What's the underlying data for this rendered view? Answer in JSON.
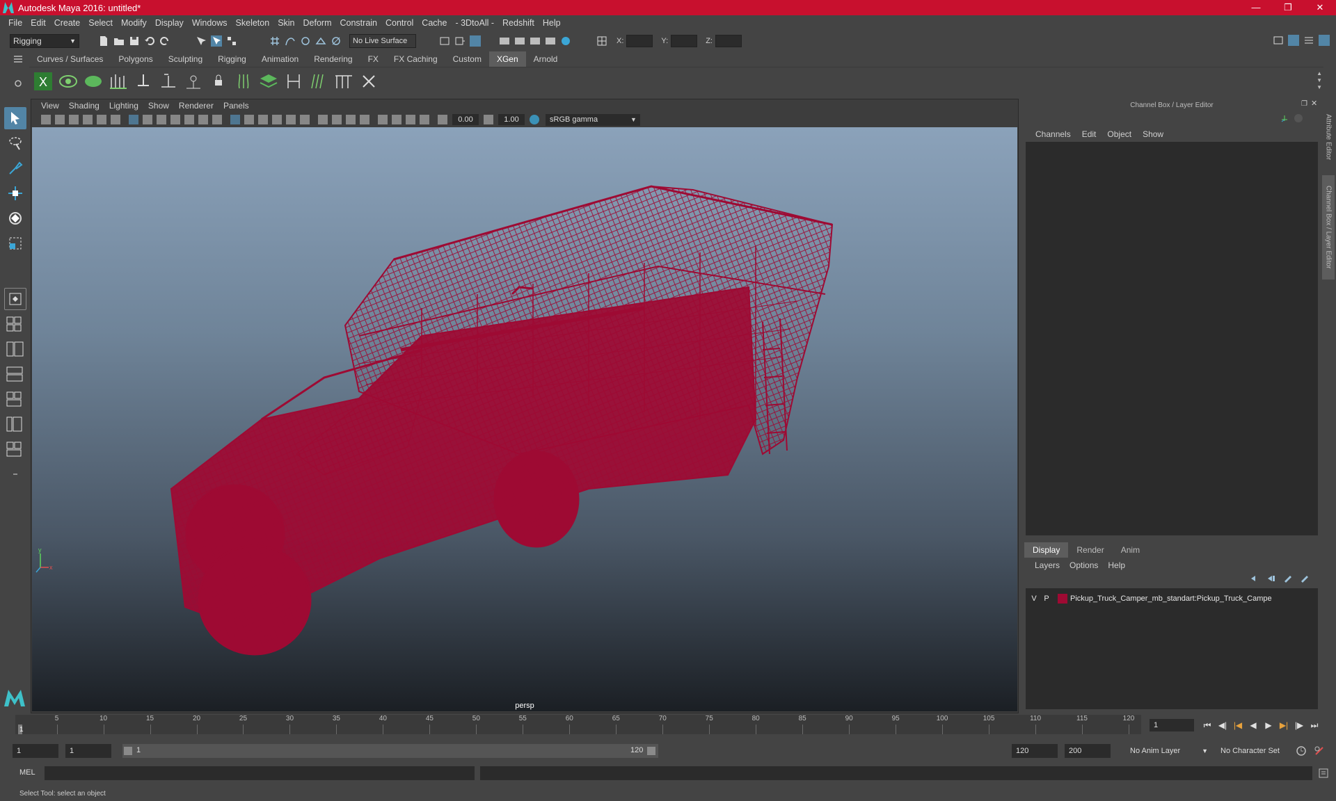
{
  "window": {
    "title": "Autodesk Maya 2016: untitled*"
  },
  "menubar": [
    "File",
    "Edit",
    "Create",
    "Select",
    "Modify",
    "Display",
    "Windows",
    "Skeleton",
    "Skin",
    "Deform",
    "Constrain",
    "Control",
    "Cache",
    "- 3DtoAll -",
    "Redshift",
    "Help"
  ],
  "statusline": {
    "menuset": "Rigging",
    "live_surface": "No Live Surface",
    "x_label": "X:",
    "y_label": "Y:",
    "z_label": "Z:"
  },
  "shelf": {
    "tabs": [
      "Curves / Surfaces",
      "Polygons",
      "Sculpting",
      "Rigging",
      "Animation",
      "Rendering",
      "FX",
      "FX Caching",
      "Custom",
      "XGen",
      "Arnold"
    ],
    "active_tab": "XGen"
  },
  "viewport": {
    "menu": [
      "View",
      "Shading",
      "Lighting",
      "Show",
      "Renderer",
      "Panels"
    ],
    "exposure": "0.00",
    "gamma_value": "1.00",
    "color_space": "sRGB gamma",
    "camera_label": "persp",
    "wire_color": "#9e0a33"
  },
  "channel_box": {
    "header": "Channel Box / Layer Editor",
    "menu": [
      "Channels",
      "Edit",
      "Object",
      "Show"
    ]
  },
  "layer_editor": {
    "tabs": [
      "Display",
      "Render",
      "Anim"
    ],
    "active_tab": "Display",
    "menu": [
      "Layers",
      "Options",
      "Help"
    ],
    "layers": [
      {
        "v": "V",
        "p": "P",
        "name": "Pickup_Truck_Camper_mb_standart:Pickup_Truck_Campe",
        "color": "#9e0a33"
      }
    ]
  },
  "side_tabs": [
    "Attribute Editor",
    "Channel Box / Layer Editor"
  ],
  "timeline": {
    "ticks": [
      5,
      10,
      15,
      20,
      25,
      30,
      35,
      40,
      45,
      50,
      55,
      60,
      65,
      70,
      75,
      80,
      85,
      90,
      95,
      100,
      105,
      110,
      115,
      120
    ],
    "current_frame_marker": "1",
    "current_frame_field": "1"
  },
  "range": {
    "start_field": "1",
    "playback_start": "1",
    "slider_start": "1",
    "slider_end": "120",
    "playback_end": "120",
    "end_field": "200",
    "anim_layer": "No Anim Layer",
    "character_set": "No Character Set"
  },
  "command_line": {
    "label": "MEL"
  },
  "help_line": {
    "text": "Select Tool: select an object"
  }
}
